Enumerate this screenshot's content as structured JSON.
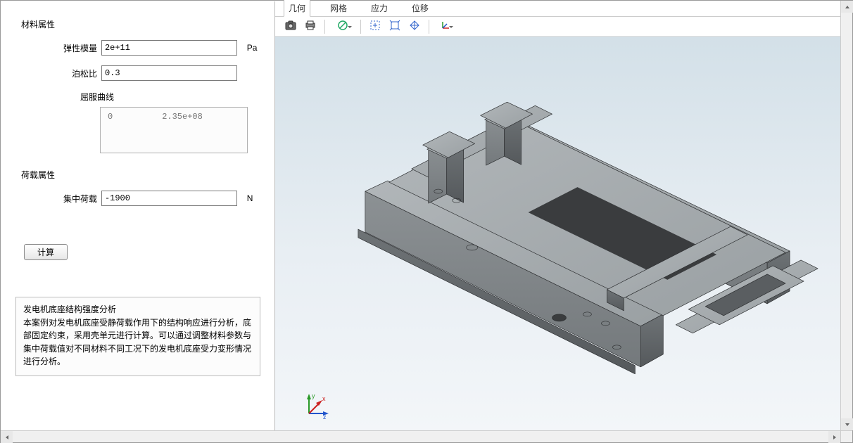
{
  "left": {
    "section_material": "材料属性",
    "elastic_label": "弹性模量",
    "elastic_value": "2e+11",
    "elastic_unit": "Pa",
    "poisson_label": "泊松比",
    "poisson_value": "0.3",
    "curve_label": "屈服曲线",
    "curve_col0": "0",
    "curve_col1": "2.35e+08",
    "section_load": "荷载属性",
    "load_label": "集中荷载",
    "load_value": "-1900",
    "load_unit": "N",
    "calc_label": "计算",
    "desc_title": "发电机底座结构强度分析",
    "desc_body": "本案例对发电机底座受静荷载作用下的结构响应进行分析，底部固定约束，采用壳单元进行计算。可以通过调整材料参数与集中荷载值对不同材料不同工况下的发电机底座受力变形情况进行分析。"
  },
  "tabs": {
    "geom": "几何",
    "mesh": "网格",
    "stress": "应力",
    "disp": "位移"
  },
  "gizmo": {
    "x": "x",
    "y": "y",
    "z": "z"
  }
}
